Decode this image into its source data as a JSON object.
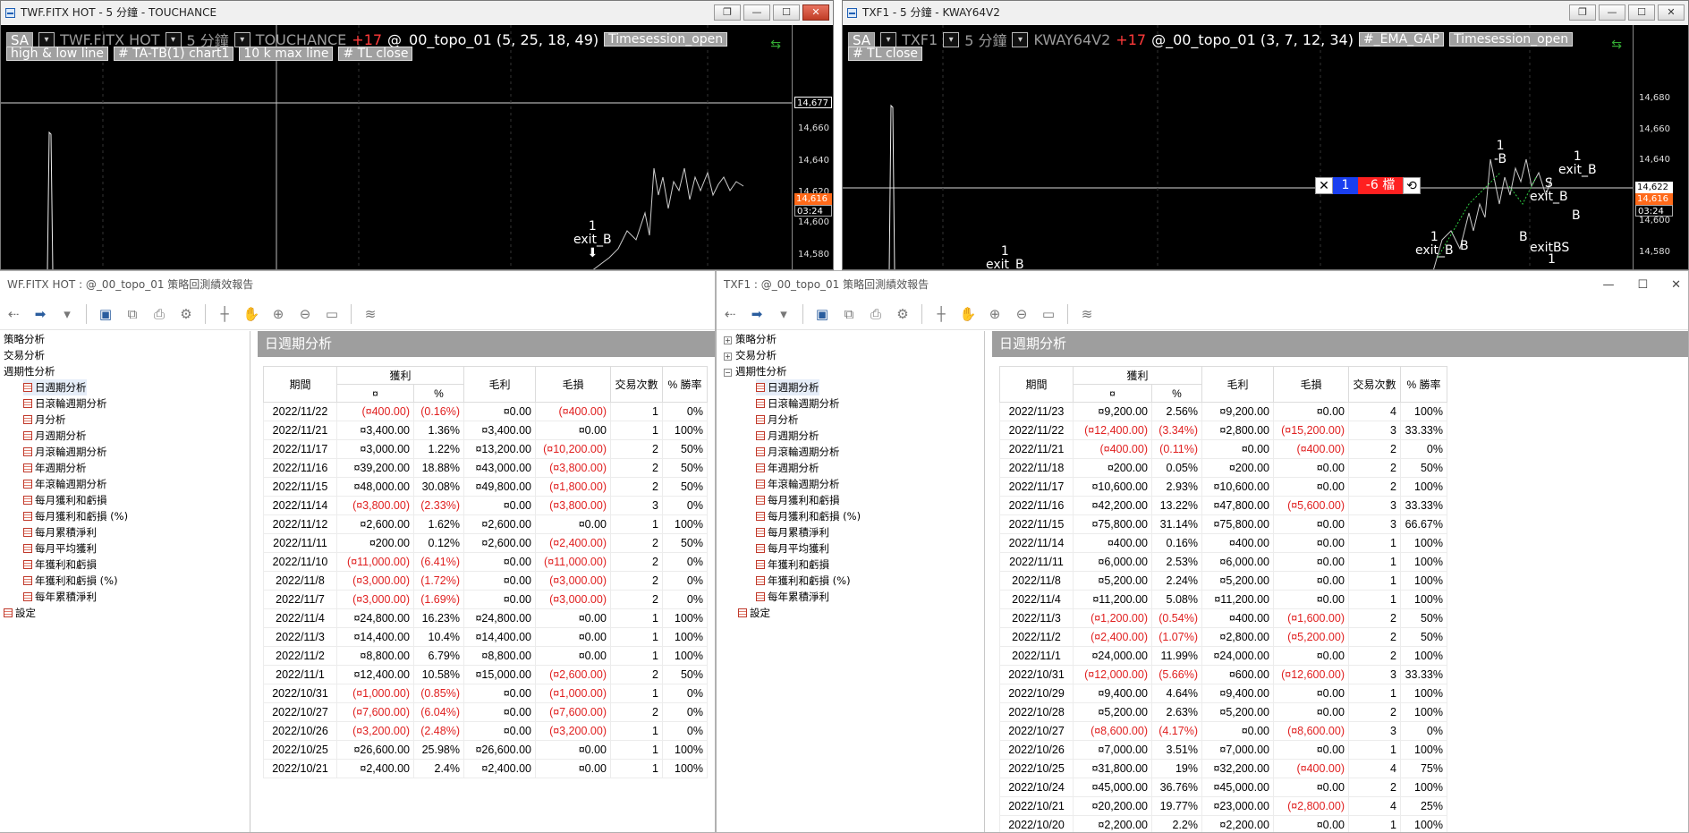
{
  "left_chart": {
    "title": "TWF.FITX HOT - 5 分鐘 - TOUCHANCE",
    "controls": {
      "sa": "SA",
      "symbol": "TWF.FITX HOT",
      "interval": "5 分鐘",
      "provider": "TOUCHANCE",
      "change": "+17",
      "strategy": "@_00_topo_01 (5,  25,  18,  49)",
      "session_chip": "Timesession_open"
    },
    "chips": [
      "high & low     line",
      "# TA-TB(1)  chart1",
      "10 k max line",
      "# TL  close"
    ],
    "axis_ticks": [
      "14,660",
      "14,640",
      "14,620",
      "14,600",
      "14,580"
    ],
    "crosshair_price": "14,677",
    "last_price": "14,616",
    "countdown": "03:24",
    "marker": {
      "top": "1",
      "label": "exit_B"
    }
  },
  "right_chart": {
    "title": "TXF1 - 5 分鐘 - KWAY64V2",
    "controls": {
      "sa": "SA",
      "symbol": "TXF1",
      "interval": "5 分鐘",
      "provider": "KWAY64V2",
      "change": "+17",
      "strategy": "@_00_topo_01 (3,  7,  12,  34)",
      "gap_chip": "#_EMA_GAP",
      "session_chip": "Timesession_open"
    },
    "chips": [
      "# TL  close"
    ],
    "axis_ticks": [
      "14,680",
      "14,660",
      "14,640",
      "14,620",
      "14,600",
      "14,580"
    ],
    "last_price": "14,622",
    "last_price2": "14,616",
    "countdown": "03:24",
    "order": {
      "close": "✕",
      "qty": "1",
      "pos": "-6 檔",
      "rev": "⟲"
    },
    "markers": [
      {
        "top": "1",
        "label": "exit_B"
      },
      {
        "top": "1",
        "label": "-B"
      },
      {
        "top": "1",
        "label": "exit_B"
      },
      {
        "top": "1",
        "label": "exit_B"
      },
      {
        "top": "S",
        "label": "exit_B"
      },
      {
        "top": "",
        "label": "B"
      },
      {
        "top": "",
        "label": "B"
      },
      {
        "top": "",
        "label": "B"
      },
      {
        "top": "",
        "label": "exitBS"
      },
      {
        "top": "1",
        "label": ""
      }
    ]
  },
  "left_report": {
    "title": "WF.FITX HOT : @_00_topo_01 策略回測績效報告",
    "section_title": "日週期分析",
    "tree": [
      {
        "label": "策略分析"
      },
      {
        "label": "交易分析"
      },
      {
        "label": "週期性分析"
      },
      {
        "label": "日週期分析"
      },
      {
        "label": "日滾輪週期分析"
      },
      {
        "label": "月分析"
      },
      {
        "label": "月週期分析"
      },
      {
        "label": "月滾輪週期分析"
      },
      {
        "label": "年週期分析"
      },
      {
        "label": "年滾輪週期分析"
      },
      {
        "label": "每月獲利和虧損"
      },
      {
        "label": "每月獲利和虧損 (%)"
      },
      {
        "label": "每月累積淨利"
      },
      {
        "label": "每月平均獲利"
      },
      {
        "label": "年獲利和虧損"
      },
      {
        "label": "年獲利和虧損 (%)"
      },
      {
        "label": "每年累積淨利"
      },
      {
        "label": "設定"
      }
    ],
    "headers": {
      "period": "期間",
      "profit": "獲利",
      "cur": "¤",
      "pct": "%",
      "gross_profit": "毛利",
      "gross_loss": "毛損",
      "trades": "交易次數",
      "winrate": "% 勝率"
    },
    "rows": [
      [
        "2022/11/22",
        "(¤400.00)",
        "(0.16%)",
        "¤0.00",
        "(¤400.00)",
        "1",
        "0%"
      ],
      [
        "2022/11/21",
        "¤3,400.00",
        "1.36%",
        "¤3,400.00",
        "¤0.00",
        "1",
        "100%"
      ],
      [
        "2022/11/17",
        "¤3,000.00",
        "1.22%",
        "¤13,200.00",
        "(¤10,200.00)",
        "2",
        "50%"
      ],
      [
        "2022/11/16",
        "¤39,200.00",
        "18.88%",
        "¤43,000.00",
        "(¤3,800.00)",
        "2",
        "50%"
      ],
      [
        "2022/11/15",
        "¤48,000.00",
        "30.08%",
        "¤49,800.00",
        "(¤1,800.00)",
        "2",
        "50%"
      ],
      [
        "2022/11/14",
        "(¤3,800.00)",
        "(2.33%)",
        "¤0.00",
        "(¤3,800.00)",
        "3",
        "0%"
      ],
      [
        "2022/11/12",
        "¤2,600.00",
        "1.62%",
        "¤2,600.00",
        "¤0.00",
        "1",
        "100%"
      ],
      [
        "2022/11/11",
        "¤200.00",
        "0.12%",
        "¤2,600.00",
        "(¤2,400.00)",
        "2",
        "50%"
      ],
      [
        "2022/11/10",
        "(¤11,000.00)",
        "(6.41%)",
        "¤0.00",
        "(¤11,000.00)",
        "2",
        "0%"
      ],
      [
        "2022/11/8",
        "(¤3,000.00)",
        "(1.72%)",
        "¤0.00",
        "(¤3,000.00)",
        "2",
        "0%"
      ],
      [
        "2022/11/7",
        "(¤3,000.00)",
        "(1.69%)",
        "¤0.00",
        "(¤3,000.00)",
        "2",
        "0%"
      ],
      [
        "2022/11/4",
        "¤24,800.00",
        "16.23%",
        "¤24,800.00",
        "¤0.00",
        "1",
        "100%"
      ],
      [
        "2022/11/3",
        "¤14,400.00",
        "10.4%",
        "¤14,400.00",
        "¤0.00",
        "1",
        "100%"
      ],
      [
        "2022/11/2",
        "¤8,800.00",
        "6.79%",
        "¤8,800.00",
        "¤0.00",
        "1",
        "100%"
      ],
      [
        "2022/11/1",
        "¤12,400.00",
        "10.58%",
        "¤15,000.00",
        "(¤2,600.00)",
        "2",
        "50%"
      ],
      [
        "2022/10/31",
        "(¤1,000.00)",
        "(0.85%)",
        "¤0.00",
        "(¤1,000.00)",
        "1",
        "0%"
      ],
      [
        "2022/10/27",
        "(¤7,600.00)",
        "(6.04%)",
        "¤0.00",
        "(¤7,600.00)",
        "2",
        "0%"
      ],
      [
        "2022/10/26",
        "(¤3,200.00)",
        "(2.48%)",
        "¤0.00",
        "(¤3,200.00)",
        "1",
        "0%"
      ],
      [
        "2022/10/25",
        "¤26,600.00",
        "25.98%",
        "¤26,600.00",
        "¤0.00",
        "1",
        "100%"
      ],
      [
        "2022/10/21",
        "¤2,400.00",
        "2.4%",
        "¤2,400.00",
        "¤0.00",
        "1",
        "100%"
      ]
    ]
  },
  "right_report": {
    "title": "TXF1 : @_00_topo_01 策略回測績效報告",
    "section_title": "日週期分析",
    "window_controls": {
      "min": "—",
      "max": "☐",
      "close": "✕"
    },
    "tree": [
      {
        "label": "策略分析"
      },
      {
        "label": "交易分析"
      },
      {
        "label": "週期性分析"
      },
      {
        "label": "日週期分析"
      },
      {
        "label": "日滾輪週期分析"
      },
      {
        "label": "月分析"
      },
      {
        "label": "月週期分析"
      },
      {
        "label": "月滾輪週期分析"
      },
      {
        "label": "年週期分析"
      },
      {
        "label": "年滾輪週期分析"
      },
      {
        "label": "每月獲利和虧損"
      },
      {
        "label": "每月獲利和虧損 (%)"
      },
      {
        "label": "每月累積淨利"
      },
      {
        "label": "每月平均獲利"
      },
      {
        "label": "年獲利和虧損"
      },
      {
        "label": "年獲利和虧損 (%)"
      },
      {
        "label": "每年累積淨利"
      },
      {
        "label": "設定"
      }
    ],
    "headers": {
      "period": "期間",
      "profit": "獲利",
      "cur": "¤",
      "pct": "%",
      "gross_profit": "毛利",
      "gross_loss": "毛損",
      "trades": "交易次數",
      "winrate": "% 勝率"
    },
    "rows": [
      [
        "2022/11/23",
        "¤9,200.00",
        "2.56%",
        "¤9,200.00",
        "¤0.00",
        "4",
        "100%"
      ],
      [
        "2022/11/22",
        "(¤12,400.00)",
        "(3.34%)",
        "¤2,800.00",
        "(¤15,200.00)",
        "3",
        "33.33%"
      ],
      [
        "2022/11/21",
        "(¤400.00)",
        "(0.11%)",
        "¤0.00",
        "(¤400.00)",
        "2",
        "0%"
      ],
      [
        "2022/11/18",
        "¤200.00",
        "0.05%",
        "¤200.00",
        "¤0.00",
        "2",
        "50%"
      ],
      [
        "2022/11/17",
        "¤10,600.00",
        "2.93%",
        "¤10,600.00",
        "¤0.00",
        "2",
        "100%"
      ],
      [
        "2022/11/16",
        "¤42,200.00",
        "13.22%",
        "¤47,800.00",
        "(¤5,600.00)",
        "3",
        "33.33%"
      ],
      [
        "2022/11/15",
        "¤75,800.00",
        "31.14%",
        "¤75,800.00",
        "¤0.00",
        "3",
        "66.67%"
      ],
      [
        "2022/11/14",
        "¤400.00",
        "0.16%",
        "¤400.00",
        "¤0.00",
        "1",
        "100%"
      ],
      [
        "2022/11/11",
        "¤6,000.00",
        "2.53%",
        "¤6,000.00",
        "¤0.00",
        "1",
        "100%"
      ],
      [
        "2022/11/8",
        "¤5,200.00",
        "2.24%",
        "¤5,200.00",
        "¤0.00",
        "1",
        "100%"
      ],
      [
        "2022/11/4",
        "¤11,200.00",
        "5.08%",
        "¤11,200.00",
        "¤0.00",
        "1",
        "100%"
      ],
      [
        "2022/11/3",
        "(¤1,200.00)",
        "(0.54%)",
        "¤400.00",
        "(¤1,600.00)",
        "2",
        "50%"
      ],
      [
        "2022/11/2",
        "(¤2,400.00)",
        "(1.07%)",
        "¤2,800.00",
        "(¤5,200.00)",
        "2",
        "50%"
      ],
      [
        "2022/11/1",
        "¤24,000.00",
        "11.99%",
        "¤24,000.00",
        "¤0.00",
        "2",
        "100%"
      ],
      [
        "2022/10/31",
        "(¤12,000.00)",
        "(5.66%)",
        "¤600.00",
        "(¤12,600.00)",
        "3",
        "33.33%"
      ],
      [
        "2022/10/29",
        "¤9,400.00",
        "4.64%",
        "¤9,400.00",
        "¤0.00",
        "1",
        "100%"
      ],
      [
        "2022/10/28",
        "¤5,200.00",
        "2.63%",
        "¤5,200.00",
        "¤0.00",
        "2",
        "100%"
      ],
      [
        "2022/10/27",
        "(¤8,600.00)",
        "(4.17%)",
        "¤0.00",
        "(¤8,600.00)",
        "3",
        "0%"
      ],
      [
        "2022/10/26",
        "¤7,000.00",
        "3.51%",
        "¤7,000.00",
        "¤0.00",
        "1",
        "100%"
      ],
      [
        "2022/10/25",
        "¤31,800.00",
        "19%",
        "¤32,200.00",
        "(¤400.00)",
        "4",
        "75%"
      ],
      [
        "2022/10/24",
        "¤45,000.00",
        "36.76%",
        "¤45,000.00",
        "¤0.00",
        "2",
        "100%"
      ],
      [
        "2022/10/21",
        "¤20,200.00",
        "19.77%",
        "¤23,000.00",
        "(¤2,800.00)",
        "4",
        "25%"
      ],
      [
        "2022/10/20",
        "¤2,200.00",
        "2.2%",
        "¤2,200.00",
        "¤0.00",
        "1",
        "100%"
      ]
    ]
  },
  "colors": {
    "negative": "#e02020",
    "header_band": "#9e9e9e",
    "last_price": "#ff6a1a",
    "order_qty": "#1a3ff0",
    "order_pos": "#ff2020"
  }
}
